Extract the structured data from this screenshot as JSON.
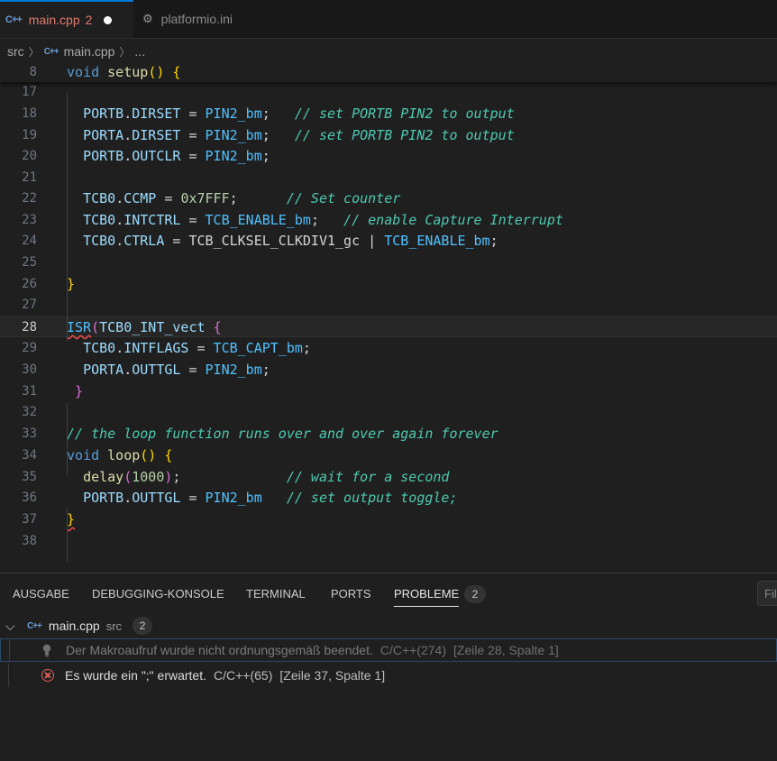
{
  "tabs": [
    {
      "icon": "cpp-file-icon",
      "icon_text": "C++",
      "label": "main.cpp",
      "count": "2",
      "modified": true
    },
    {
      "icon": "gear-icon",
      "label": "platformio.ini"
    }
  ],
  "breadcrumb": {
    "folder": "src",
    "file": "main.cpp",
    "ellipsis": "..."
  },
  "editor": {
    "lines": [
      {
        "n": "8",
        "code": [
          [
            "kw",
            "void"
          ],
          [
            "plain",
            " "
          ],
          [
            "fn",
            "setup"
          ],
          [
            "br1",
            "()"
          ],
          [
            "plain",
            " "
          ],
          [
            "br1",
            "{"
          ]
        ]
      },
      {
        "n": "17",
        "code": []
      },
      {
        "n": "18",
        "code": [
          [
            "plain",
            "  "
          ],
          [
            "var",
            "PORTB"
          ],
          [
            "plain",
            "."
          ],
          [
            "var",
            "DIRSET"
          ],
          [
            "plain",
            " = "
          ],
          [
            "mac",
            "PIN2_bm"
          ],
          [
            "plain",
            ";   "
          ],
          [
            "cmt2",
            "// set PORTB PIN2 to output"
          ]
        ]
      },
      {
        "n": "19",
        "code": [
          [
            "plain",
            "  "
          ],
          [
            "var",
            "PORTA"
          ],
          [
            "plain",
            "."
          ],
          [
            "var",
            "DIRSET"
          ],
          [
            "plain",
            " = "
          ],
          [
            "mac",
            "PIN2_bm"
          ],
          [
            "plain",
            ";   "
          ],
          [
            "cmt2",
            "// set PORTB PIN2 to output"
          ]
        ]
      },
      {
        "n": "20",
        "code": [
          [
            "plain",
            "  "
          ],
          [
            "var",
            "PORTB"
          ],
          [
            "plain",
            "."
          ],
          [
            "var",
            "OUTCLR"
          ],
          [
            "plain",
            " = "
          ],
          [
            "mac",
            "PIN2_bm"
          ],
          [
            "plain",
            ";"
          ]
        ]
      },
      {
        "n": "21",
        "code": []
      },
      {
        "n": "22",
        "code": [
          [
            "plain",
            "  "
          ],
          [
            "var",
            "TCB0"
          ],
          [
            "plain",
            "."
          ],
          [
            "var",
            "CCMP"
          ],
          [
            "plain",
            " = "
          ],
          [
            "num",
            "0x7FFF"
          ],
          [
            "plain",
            ";      "
          ],
          [
            "cmt2",
            "// Set counter"
          ]
        ]
      },
      {
        "n": "23",
        "code": [
          [
            "plain",
            "  "
          ],
          [
            "var",
            "TCB0"
          ],
          [
            "plain",
            "."
          ],
          [
            "var",
            "INTCTRL"
          ],
          [
            "plain",
            " = "
          ],
          [
            "mac",
            "TCB_ENABLE_bm"
          ],
          [
            "plain",
            ";   "
          ],
          [
            "cmt2",
            "// enable Capture Interrupt"
          ]
        ]
      },
      {
        "n": "24",
        "code": [
          [
            "plain",
            "  "
          ],
          [
            "var",
            "TCB0"
          ],
          [
            "plain",
            "."
          ],
          [
            "var",
            "CTRLA"
          ],
          [
            "plain",
            " = TCB_CLKSEL_CLKDIV1_gc | "
          ],
          [
            "mac",
            "TCB_ENABLE_bm"
          ],
          [
            "plain",
            ";"
          ]
        ]
      },
      {
        "n": "25",
        "code": []
      },
      {
        "n": "26",
        "code": [
          [
            "br1",
            "}"
          ]
        ]
      },
      {
        "n": "27",
        "code": []
      },
      {
        "n": "28",
        "code": [
          [
            "mac squiggle",
            "ISR"
          ],
          [
            "br2",
            "("
          ],
          [
            "var",
            "TCB0_INT_vect"
          ],
          [
            "plain",
            " "
          ],
          [
            "br2",
            "{"
          ]
        ],
        "current": true
      },
      {
        "n": "29",
        "code": [
          [
            "plain",
            "  "
          ],
          [
            "var",
            "TCB0"
          ],
          [
            "plain",
            "."
          ],
          [
            "var",
            "INTFLAGS"
          ],
          [
            "plain",
            " = "
          ],
          [
            "mac",
            "TCB_CAPT_bm"
          ],
          [
            "plain",
            ";"
          ]
        ]
      },
      {
        "n": "30",
        "code": [
          [
            "plain",
            "  "
          ],
          [
            "var",
            "PORTA"
          ],
          [
            "plain",
            "."
          ],
          [
            "var",
            "OUTTGL"
          ],
          [
            "plain",
            " = "
          ],
          [
            "mac",
            "PIN2_bm"
          ],
          [
            "plain",
            ";"
          ]
        ]
      },
      {
        "n": "31",
        "code": [
          [
            "plain",
            " "
          ],
          [
            "br2",
            "}"
          ]
        ]
      },
      {
        "n": "32",
        "code": []
      },
      {
        "n": "33",
        "code": [
          [
            "cmt2",
            "// the loop function runs over and over again forever"
          ]
        ]
      },
      {
        "n": "34",
        "code": [
          [
            "kw",
            "void"
          ],
          [
            "plain",
            " "
          ],
          [
            "fn",
            "loop"
          ],
          [
            "br1",
            "()"
          ],
          [
            "plain",
            " "
          ],
          [
            "br1",
            "{"
          ]
        ]
      },
      {
        "n": "35",
        "code": [
          [
            "plain",
            "  "
          ],
          [
            "fn",
            "delay"
          ],
          [
            "br2",
            "("
          ],
          [
            "num",
            "1000"
          ],
          [
            "br2",
            ")"
          ],
          [
            "plain",
            ";             "
          ],
          [
            "cmt2",
            "// wait for a second"
          ]
        ]
      },
      {
        "n": "36",
        "code": [
          [
            "plain",
            "  "
          ],
          [
            "var",
            "PORTB"
          ],
          [
            "plain",
            "."
          ],
          [
            "var",
            "OUTTGL"
          ],
          [
            "plain",
            " = "
          ],
          [
            "mac",
            "PIN2_bm"
          ],
          [
            "plain",
            "   "
          ],
          [
            "cmt2",
            "// set output toggle;"
          ]
        ]
      },
      {
        "n": "37",
        "code": [
          [
            "br1 squiggle",
            "}"
          ]
        ]
      },
      {
        "n": "38",
        "code": []
      }
    ]
  },
  "panel": {
    "tabs": [
      "AUSGABE",
      "DEBUGGING-KONSOLE",
      "TERMINAL",
      "PORTS",
      "PROBLEME"
    ],
    "active_tab": "PROBLEME",
    "problems_count": "2",
    "filter_placeholder": "Fil",
    "file": {
      "name": "main.cpp",
      "dir": "src",
      "count": "2"
    },
    "problems": [
      {
        "severity": "info",
        "icon": "lightbulb-icon",
        "message": "Der Makroaufruf wurde nicht ordnungsgemäß beendet.",
        "source": "C/C++(274)",
        "location": "[Zeile 28, Spalte 1]"
      },
      {
        "severity": "error",
        "icon": "error-icon",
        "message": "Es wurde ein \";\" erwartet.",
        "source": "C/C++(65)",
        "location": "[Zeile 37, Spalte 1]"
      }
    ]
  }
}
